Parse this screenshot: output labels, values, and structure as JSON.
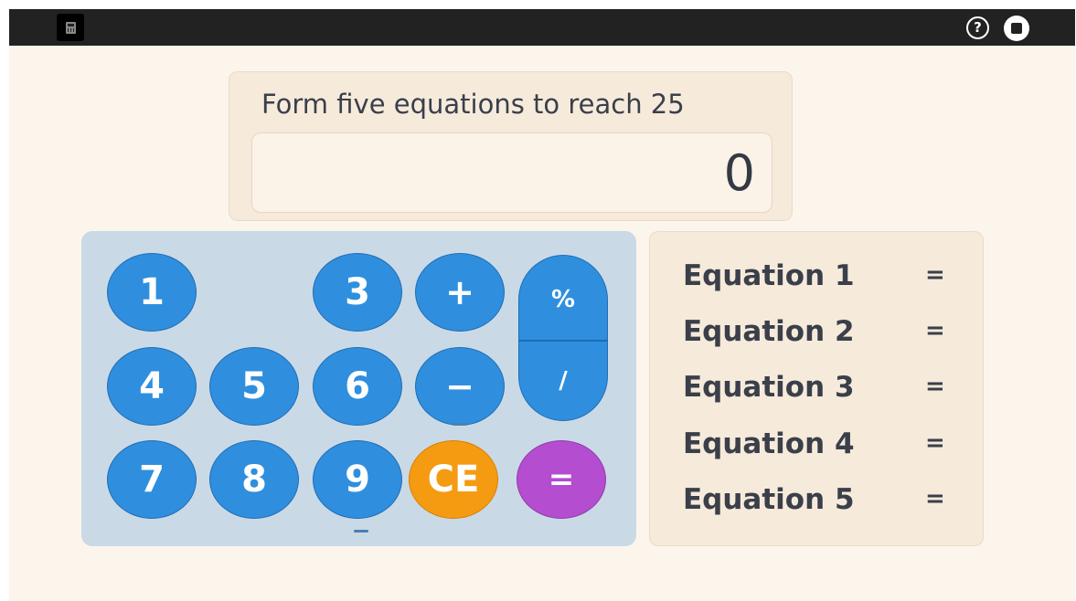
{
  "topbar": {
    "app_icon": "calculator-icon",
    "help_icon": "help-icon",
    "help_glyph": "?",
    "stop_icon": "stop-icon"
  },
  "prompt": {
    "title": "Form five equations to reach 25",
    "display_value": "0"
  },
  "keypad": {
    "keys": {
      "k1": "1",
      "k3": "3",
      "k4": "4",
      "k5": "5",
      "k6": "6",
      "k7": "7",
      "k8": "8",
      "k9": "9",
      "plus": "+",
      "minus": "−",
      "percent": "%",
      "divide": "/",
      "clear": "CE",
      "equals": "="
    }
  },
  "equations": [
    {
      "label": "Equation 1",
      "sign": "="
    },
    {
      "label": "Equation 2",
      "sign": "="
    },
    {
      "label": "Equation 3",
      "sign": "="
    },
    {
      "label": "Equation 4",
      "sign": "="
    },
    {
      "label": "Equation 5",
      "sign": "="
    }
  ],
  "colors": {
    "background": "#fcf5ec",
    "topbar": "#222222",
    "key_blue": "#2f8fde",
    "key_orange": "#f59b12",
    "key_purple": "#b44dd0",
    "keypad_bg": "#cad9e6",
    "panel_bg": "#f6eadb"
  }
}
